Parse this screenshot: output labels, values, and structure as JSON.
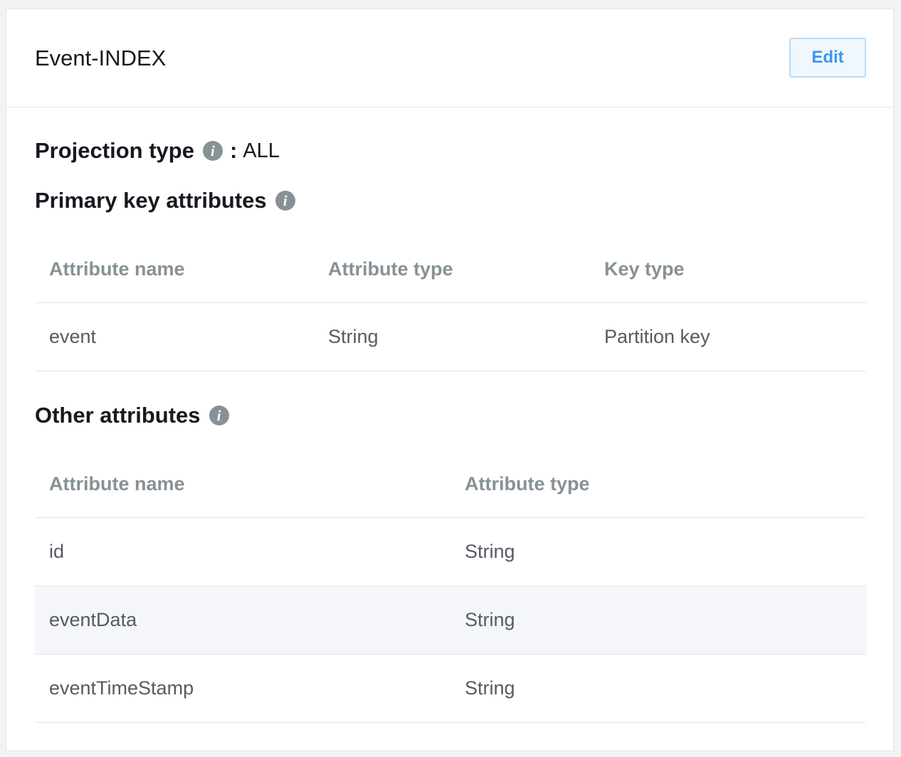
{
  "index": {
    "title": "Event-INDEX",
    "edit_label": "Edit"
  },
  "projection": {
    "label": "Projection type",
    "separator": ":",
    "value": "ALL",
    "icon": "info-icon"
  },
  "primary_key_section": {
    "heading": "Primary key attributes",
    "icon": "info-icon",
    "columns": [
      "Attribute name",
      "Attribute type",
      "Key type"
    ],
    "rows": [
      [
        "event",
        "String",
        "Partition key"
      ]
    ]
  },
  "other_attributes_section": {
    "heading": "Other attributes",
    "icon": "info-icon",
    "columns": [
      "Attribute name",
      "Attribute type"
    ],
    "rows": [
      [
        "id",
        "String"
      ],
      [
        "eventData",
        "String"
      ],
      [
        "eventTimeStamp",
        "String"
      ]
    ],
    "highlighted_row": 1
  },
  "info_icon_glyph": "i",
  "colors": {
    "accent": "#3b97f0",
    "header_text": "#879196",
    "border": "#e3e5e8",
    "row_highlight": "#f4f6f9"
  }
}
